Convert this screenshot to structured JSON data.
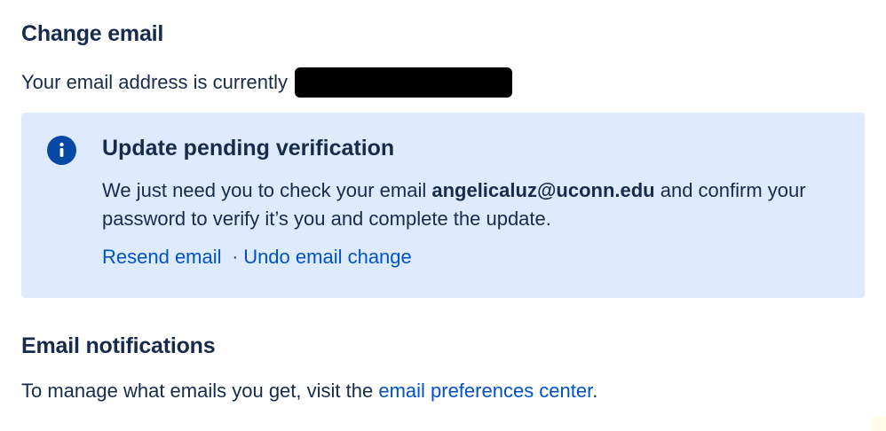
{
  "change_email": {
    "title": "Change email",
    "current_prefix": "Your email address is currently"
  },
  "pending_panel": {
    "icon": "info-icon",
    "title": "Update pending verification",
    "body_before": "We just need you to check your email ",
    "email": "angelicaluz@uconn.edu",
    "body_after": " and confirm your password to verify it’s you and complete the update.",
    "resend_label": "Resend email",
    "separator": "·",
    "undo_label": "Undo email change"
  },
  "notifications": {
    "title": "Email notifications",
    "text_before": "To manage what emails you get, visit the ",
    "link_label": "email preferences center",
    "text_after": "."
  },
  "colors": {
    "panel_background": "#deebff",
    "link": "#0052cc",
    "text": "#172b4d",
    "icon": "#0747a6"
  }
}
